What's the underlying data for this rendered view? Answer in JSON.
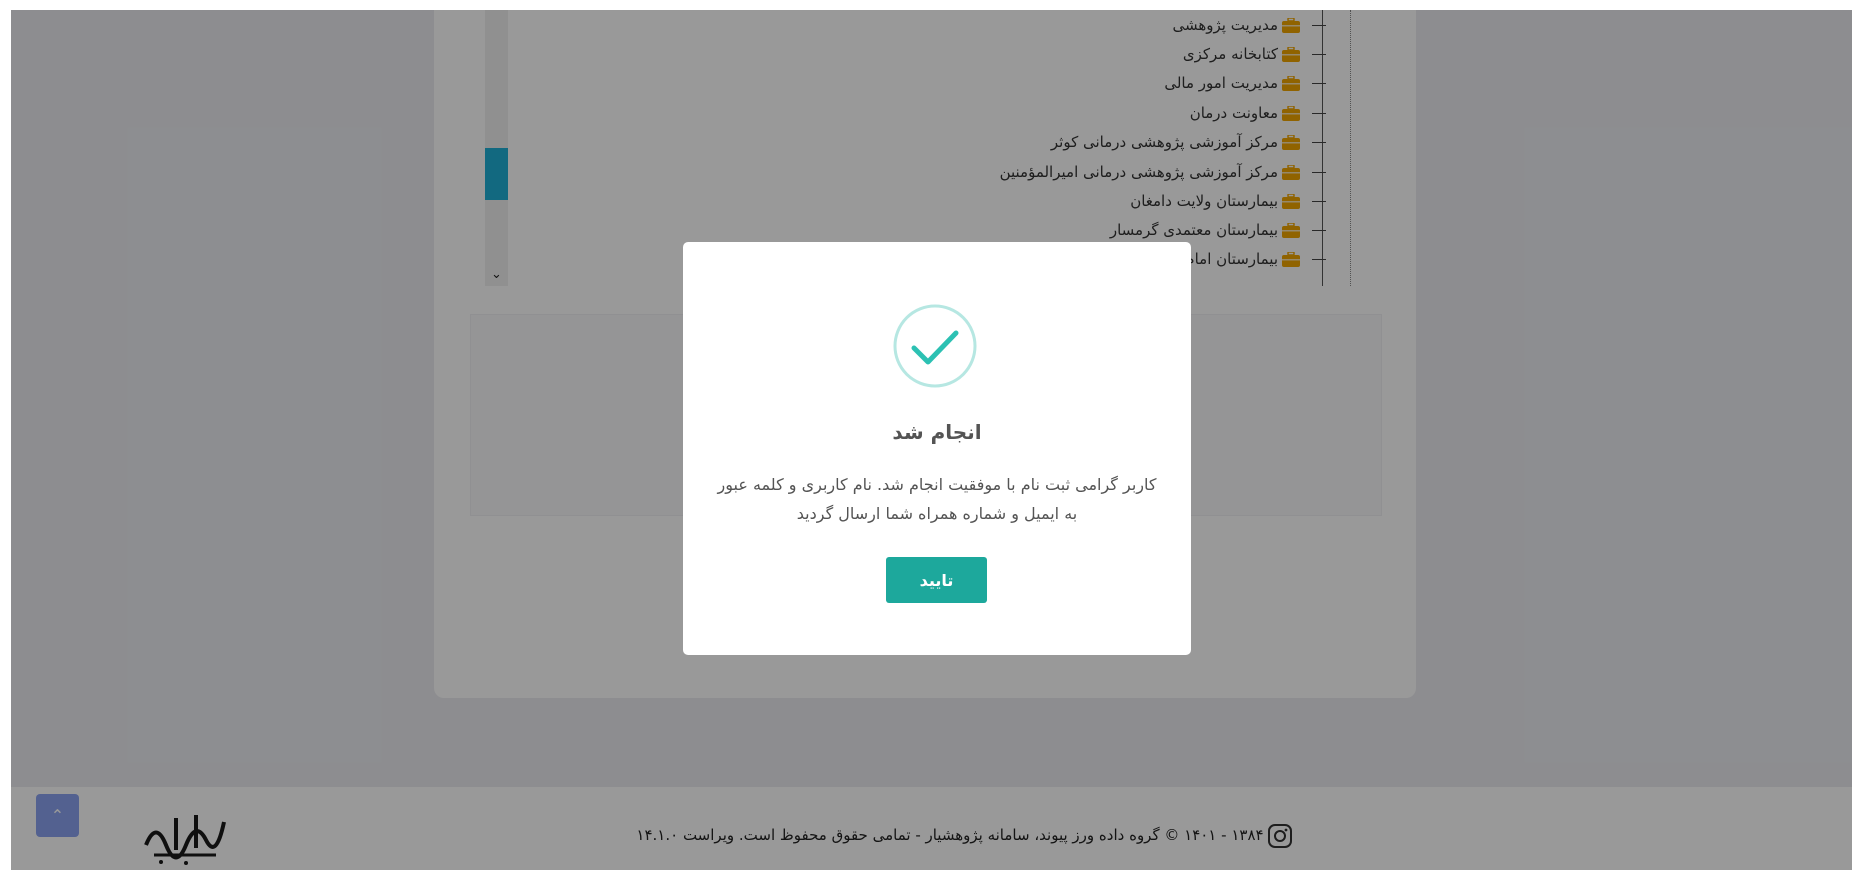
{
  "tree": {
    "items": [
      {
        "label": "مدیریت پژوهشی"
      },
      {
        "label": "کتابخانه مرکزی"
      },
      {
        "label": "مدیریت امور مالی"
      },
      {
        "label": "معاونت درمان"
      },
      {
        "label": "مرکز آموزشی پژوهشی درمانی کوثر"
      },
      {
        "label": "مرکز آموزشی پژوهشی درمانی امیرالمؤمنین"
      },
      {
        "label": "بیمارستان ولایت دامغان"
      },
      {
        "label": "بیمارستان معتمدی گرمسار"
      },
      {
        "label": "بیمارستان امام"
      }
    ]
  },
  "modal": {
    "title": "انجام شد",
    "message": "کاربر گرامی ثبت نام با موفقیت انجام شد. نام کاربری و کلمه عبور به ایمیل و شماره همراه شما ارسال گردید",
    "confirm_label": "تایید"
  },
  "footer": {
    "copyright": "۱۳۸۴ - ۱۴۰۱ © گروه داده ورز پیوند، سامانه پژوهشیار - تمامی حقوق محفوظ است. ویراست ۱۴.۱.۰",
    "logo_text": "پژوهشیار"
  },
  "colors": {
    "accent": "#1da89c",
    "folder": "#f0a500",
    "scroll_thumb": "#1fb0d6",
    "up_button": "#8aa2f0"
  },
  "icons": {
    "tree_item": "folder-icon",
    "success": "check-circle-icon",
    "social": "instagram-icon",
    "scroll_top": "chevron-up-icon"
  }
}
